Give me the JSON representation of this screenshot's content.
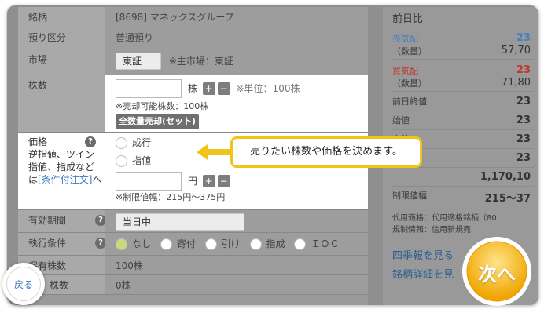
{
  "form": {
    "stock": {
      "label": "銘柄",
      "value": "[8698] マネックスグループ"
    },
    "custody": {
      "label": "預り区分",
      "value": "普通預り"
    },
    "market": {
      "label": "市場",
      "value": "東証",
      "note": "※主市場：東証"
    },
    "quantity": {
      "label": "株数",
      "unit": "株",
      "note": "※単位：100株",
      "sellable": "※売却可能株数：100株",
      "sell_all": "全数量売却(セット)"
    },
    "price": {
      "label": "価格",
      "desc": "逆指値、ツイン指値、指成などは",
      "link": "[条件付注文]",
      "desc_end": "へ",
      "opt_market": "成行",
      "opt_limit": "指値",
      "unit": "円",
      "range": "※制限値幅：215円〜375円"
    },
    "expiry": {
      "label": "有効期間",
      "value": "当日中"
    },
    "condition": {
      "label": "執行条件",
      "options": [
        "なし",
        "寄付",
        "引け",
        "指成",
        "ＩＯＣ"
      ]
    },
    "holdings": {
      "label": "保有株数",
      "value": "100株"
    },
    "pending": {
      "label": "株数",
      "value": "0株"
    }
  },
  "right": {
    "prev": "前日比",
    "ask": "売気配",
    "ask_qty_label": "（数量）",
    "ask_value": "23",
    "ask_qty": "57,70",
    "bid": "買気配",
    "bid_qty_label": "（数量）",
    "bid_value": "23",
    "bid_qty": "71,80",
    "prev_close": "前日終値",
    "prev_close_value": "23",
    "open": "始値",
    "open_value": "23",
    "high": "高値",
    "high_value": "23",
    "low_value": "23",
    "volume_value": "1,170,10",
    "limit": "制限値幅",
    "limit_value": "215〜37",
    "collateral": "代用適格：代用適格銘柄（80",
    "margin": "規制情報：信用新規売",
    "link1": "四季報を見る",
    "link2": "銘柄詳細を見"
  },
  "tooltip": "売りたい株数や価格を決めます。",
  "nav": {
    "back": "戻る",
    "next": "次へ"
  },
  "colors": {
    "accent": "#f0c419",
    "link": "#3a78c2",
    "ask": "#4a7fc0",
    "bid": "#c0392b"
  }
}
